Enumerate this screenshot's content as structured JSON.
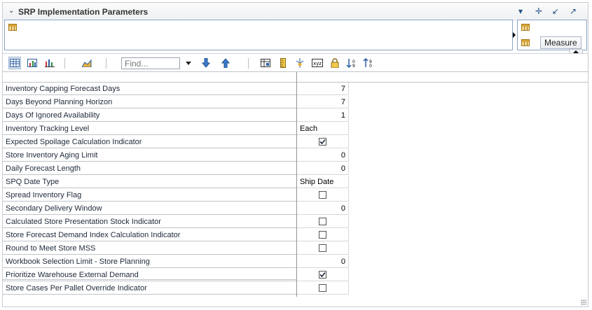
{
  "window": {
    "title": "SRP Implementation Parameters"
  },
  "titlebar_icons": [
    "chevron-down-icon",
    "move-icon",
    "minimize-icon",
    "maximize-icon"
  ],
  "pivot": {
    "column_tile": "Measure"
  },
  "toolbar": {
    "find_placeholder": "Find..."
  },
  "colors": {
    "accent": "#1f4f86",
    "border": "#8aa4c4",
    "check": "#1e2a3a"
  },
  "rows": [
    {
      "label": "Inventory Capping Forecast Days",
      "type": "num",
      "value": "7"
    },
    {
      "label": "Days Beyond Planning Horizon",
      "type": "num",
      "value": "7"
    },
    {
      "label": "Days Of Ignored Availability",
      "type": "num",
      "value": "1"
    },
    {
      "label": "Inventory Tracking Level",
      "type": "txt",
      "value": "Each"
    },
    {
      "label": "Expected Spoilage Calculation Indicator",
      "type": "check",
      "checked": true
    },
    {
      "label": "Store Inventory Aging Limit",
      "type": "num",
      "value": "0"
    },
    {
      "label": "Daily Forecast Length",
      "type": "num",
      "value": "0"
    },
    {
      "label": "SPQ Date Type",
      "type": "txt",
      "value": "Ship Date"
    },
    {
      "label": "Spread Inventory Flag",
      "type": "check",
      "checked": false
    },
    {
      "label": "Secondary Delivery Window",
      "type": "num",
      "value": "0"
    },
    {
      "label": "Calculated Store Presentation Stock Indicator",
      "type": "check",
      "checked": false
    },
    {
      "label": "Store Forecast Demand Index Calculation Indicator",
      "type": "check",
      "checked": false
    },
    {
      "label": "Round to Meet Store MSS",
      "type": "check",
      "checked": false
    },
    {
      "label": "Workbook Selection Limit - Store Planning",
      "type": "num",
      "value": "0"
    },
    {
      "label": "Prioritize Warehouse External Demand",
      "type": "check",
      "checked": true
    },
    {
      "label": "Store Cases Per Pallet Override Indicator",
      "type": "check",
      "checked": false
    }
  ]
}
